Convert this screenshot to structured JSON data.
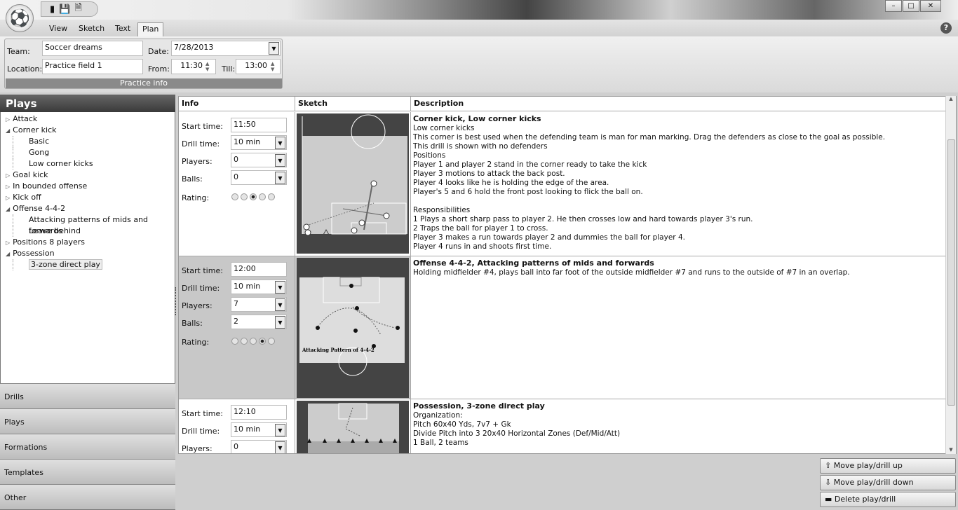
{
  "qat": {
    "icons": [
      "clipboard-icon",
      "save-icon",
      "document-icon"
    ]
  },
  "window": {
    "minimize": "–",
    "maximize": "□",
    "close": "✕"
  },
  "tabs": [
    {
      "label": "View"
    },
    {
      "label": "Sketch"
    },
    {
      "label": "Text"
    },
    {
      "label": "Plan",
      "active": true
    }
  ],
  "help": "?",
  "practice": {
    "team_label": "Team:",
    "team": "Soccer dreams",
    "date_label": "Date:",
    "date": "7/28/2013",
    "location_label": "Location:",
    "location": "Practice field 1",
    "from_label": "From:",
    "from": "11:30",
    "till_label": "Till:",
    "till": "13:00",
    "group_label": "Practice info"
  },
  "sidebar": {
    "title": "Plays",
    "tree": [
      {
        "label": "Attack",
        "level": 0,
        "exp": "▷"
      },
      {
        "label": "Corner kick",
        "level": 0,
        "exp": "◢"
      },
      {
        "label": "Basic",
        "level": 1
      },
      {
        "label": "Gong",
        "level": 1
      },
      {
        "label": "Low corner kicks",
        "level": 1
      },
      {
        "label": "Goal kick",
        "level": 0,
        "exp": "▷"
      },
      {
        "label": "In bounded offense",
        "level": 0,
        "exp": "▷"
      },
      {
        "label": "Kick off",
        "level": 0,
        "exp": "▷"
      },
      {
        "label": "Offense 4-4-2",
        "level": 0,
        "exp": "◢"
      },
      {
        "label": "Attacking patterns of mids and forwards",
        "level": 1
      },
      {
        "label": "Leave behind",
        "level": 1
      },
      {
        "label": "Positions 8 players",
        "level": 0,
        "exp": "▷"
      },
      {
        "label": "Possession",
        "level": 0,
        "exp": "◢"
      },
      {
        "label": "3-zone direct play",
        "level": 1,
        "selected": true
      }
    ],
    "nav": [
      "Drills",
      "Plays",
      "Formations",
      "Templates",
      "Other"
    ]
  },
  "table": {
    "headers": [
      "Info",
      "Sketch",
      "Description"
    ],
    "labels": {
      "start": "Start time:",
      "drill": "Drill time:",
      "players": "Players:",
      "balls": "Balls:",
      "rating": "Rating:"
    },
    "rows": [
      {
        "start": "11:50",
        "drill": "10 min",
        "players": "0",
        "balls": "0",
        "rating": 3,
        "title": "Corner kick, Low corner kicks",
        "desc": "Low corner kicks\nThis corner is best used when the defending team is man for man marking. Drag the defenders as close to the goal as possible.\nThis drill is shown with no defenders\nPositions\nPlayer 1 and player 2 stand in the corner ready to take the kick\nPlayer 3 motions to attack the back post.\nPlayer 4 looks like he is holding the edge of the area.\nPlayer's 5 and 6 hold the front post looking to flick the ball on.\n\nResponsibilities\n1 Plays a short sharp pass to player 2. He then crosses low and hard towards player 3's run.\n2 Traps the ball for player 1 to cross.\nPlayer 3 makes a run towards player 2 and dummies the ball for player 4.\nPlayer 4 runs in and shoots first time."
      },
      {
        "start": "12:00",
        "drill": "10 min",
        "players": "7",
        "balls": "2",
        "rating": 4,
        "title": "Offense 4-4-2, Attacking patterns of mids and forwards",
        "desc": "Holding midfielder #4, plays ball into far foot of the outside midfielder #7 and runs to the outside of #7 in an overlap.",
        "sketch_caption": "Attacking Pattern of 4-4-2"
      },
      {
        "start": "12:10",
        "drill": "10 min",
        "players": "0",
        "title": "Possession, 3-zone direct play",
        "desc": "Organization:\nPitch 60x40 Yds, 7v7 + Gk\nDivide Pitch into 3 20x40 Horizontal Zones (Def/Mid/Att)\n1 Ball, 2 teams"
      }
    ]
  },
  "actions": {
    "up": "Move play/drill up",
    "down": "Move play/drill down",
    "delete": "Delete play/drill"
  }
}
